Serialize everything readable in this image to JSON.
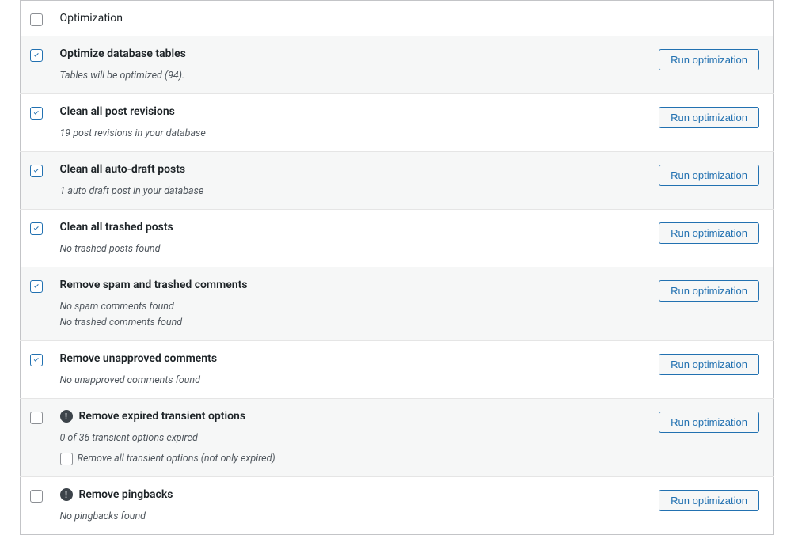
{
  "header": {
    "column_title": "Optimization"
  },
  "buttons": {
    "run": "Run optimization"
  },
  "icons": {
    "warning_glyph": "!"
  },
  "rows": [
    {
      "checked": true,
      "warning": false,
      "title": "Optimize database tables",
      "desc": [
        "Tables will be optimized (94)."
      ]
    },
    {
      "checked": true,
      "warning": false,
      "title": "Clean all post revisions",
      "desc": [
        "19 post revisions in your database"
      ]
    },
    {
      "checked": true,
      "warning": false,
      "title": "Clean all auto-draft posts",
      "desc": [
        "1 auto draft post in your database"
      ]
    },
    {
      "checked": true,
      "warning": false,
      "title": "Clean all trashed posts",
      "desc": [
        "No trashed posts found"
      ]
    },
    {
      "checked": true,
      "warning": false,
      "title": "Remove spam and trashed comments",
      "desc": [
        "No spam comments found",
        "No trashed comments found"
      ]
    },
    {
      "checked": true,
      "warning": false,
      "title": "Remove unapproved comments",
      "desc": [
        "No unapproved comments found"
      ]
    },
    {
      "checked": false,
      "warning": true,
      "title": "Remove expired transient options",
      "desc": [
        "0 of 36 transient options expired"
      ],
      "sub_option": {
        "checked": false,
        "label": "Remove all transient options (not only expired)"
      }
    },
    {
      "checked": false,
      "warning": true,
      "title": "Remove pingbacks",
      "desc": [
        "No pingbacks found"
      ]
    }
  ]
}
